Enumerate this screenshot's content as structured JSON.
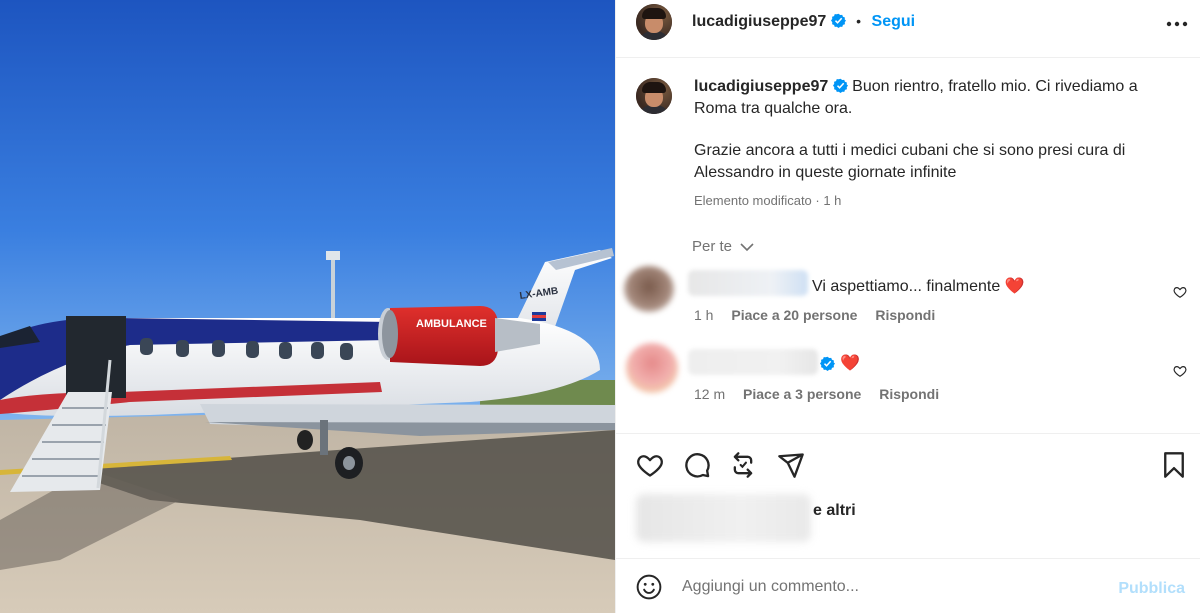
{
  "post": {
    "username": "lucadigiuseppe97",
    "verified_icon": "verified-badge-icon",
    "separator": "•",
    "follow_label": "Segui",
    "more_icon": "more-options-icon",
    "image_text": {
      "engine_label": "AMBULANCE",
      "registration": "LX-AMB"
    }
  },
  "caption": {
    "username": "lucadigiuseppe97",
    "paragraph_1": "Buon rientro, fratello mio. Ci rivediamo a Roma tra qualche ora.",
    "paragraph_2": "Grazie ancora a tutti i medici cubani che si sono presi cura di Alessandro in queste giornate infinite",
    "meta": "Elemento modificato · 1 h"
  },
  "comments_filter": {
    "label": "Per te"
  },
  "comments": [
    {
      "text": "Vi aspettiamo... finalmente",
      "emoji": "❤️",
      "time": "1 h",
      "likes": "Piace a 20 persone",
      "reply": "Rispondi"
    },
    {
      "text": "",
      "emoji": "❤️",
      "time": "12 m",
      "likes": "Piace a 3 persone",
      "reply": "Rispondi"
    }
  ],
  "likes": {
    "suffix": "e altri"
  },
  "add_comment": {
    "placeholder": "Aggiungi un commento...",
    "publish_label": "Pubblica"
  },
  "colors": {
    "link_blue": "#0095f6",
    "publish_disabled": "#b2dffc",
    "secondary_text": "#737373",
    "heart_pink": "#ed4956"
  }
}
